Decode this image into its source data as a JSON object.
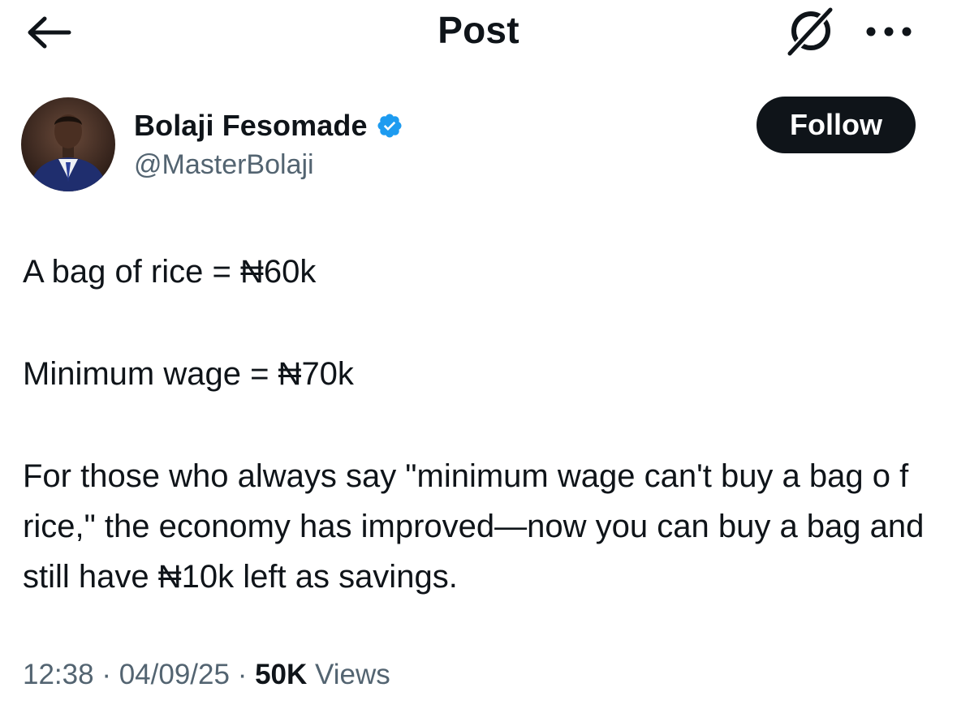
{
  "header": {
    "title": "Post",
    "back_icon": "arrow-left-icon",
    "grok_icon": "grok-icon",
    "more_icon": "more-horizontal-icon"
  },
  "author": {
    "display_name": "Bolaji Fesomade",
    "handle": "@MasterBolaji",
    "verified": true,
    "verified_color": "#1d9bf0",
    "follow_label": "Follow"
  },
  "post": {
    "paragraph_1": "A bag of rice = ₦60k",
    "paragraph_2": "Minimum wage = ₦70k",
    "paragraph_3": "For those who always say \"minimum wage can't buy a bag o f rice,\" the economy has improved—now you can buy a bag and still have ₦10k left as savings."
  },
  "meta": {
    "time": "12:38",
    "separator": "·",
    "date": "04/09/25",
    "views_count": "50K",
    "views_label": "Views"
  },
  "colors": {
    "text_primary": "#0f1419",
    "text_secondary": "#536471",
    "follow_bg": "#0f1419",
    "follow_text": "#ffffff"
  }
}
